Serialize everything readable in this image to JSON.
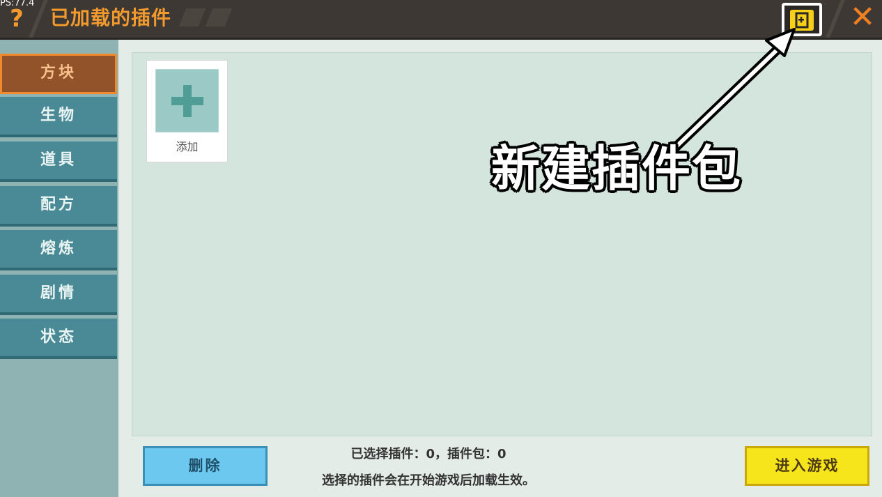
{
  "app": {
    "fps_text": "PS:77.4",
    "title": "已加载的插件",
    "help_label": "?",
    "close_label": "✕",
    "newpack_icon": "new-pack-icon"
  },
  "sidebar": {
    "items": [
      {
        "label": "方块",
        "active": true
      },
      {
        "label": "生物",
        "active": false
      },
      {
        "label": "道具",
        "active": false
      },
      {
        "label": "配方",
        "active": false
      },
      {
        "label": "熔炼",
        "active": false
      },
      {
        "label": "剧情",
        "active": false
      },
      {
        "label": "状态",
        "active": false
      }
    ]
  },
  "main": {
    "add_label": "添加"
  },
  "annotation": {
    "text": "新建插件包"
  },
  "footer": {
    "delete_label": "删除",
    "status_line1": "已选择插件：0，插件包：0",
    "status_line2": "选择的插件会在开始游戏后加载生效。",
    "enter_label": "进入游戏"
  },
  "colors": {
    "accent_orange": "#f29a2e",
    "sidebar_teal": "#4a8a96",
    "active_brown": "#93532a",
    "new_pack_yellow": "#f6cf19",
    "enter_yellow": "#f7e51c",
    "delete_blue": "#6dc8ef"
  }
}
